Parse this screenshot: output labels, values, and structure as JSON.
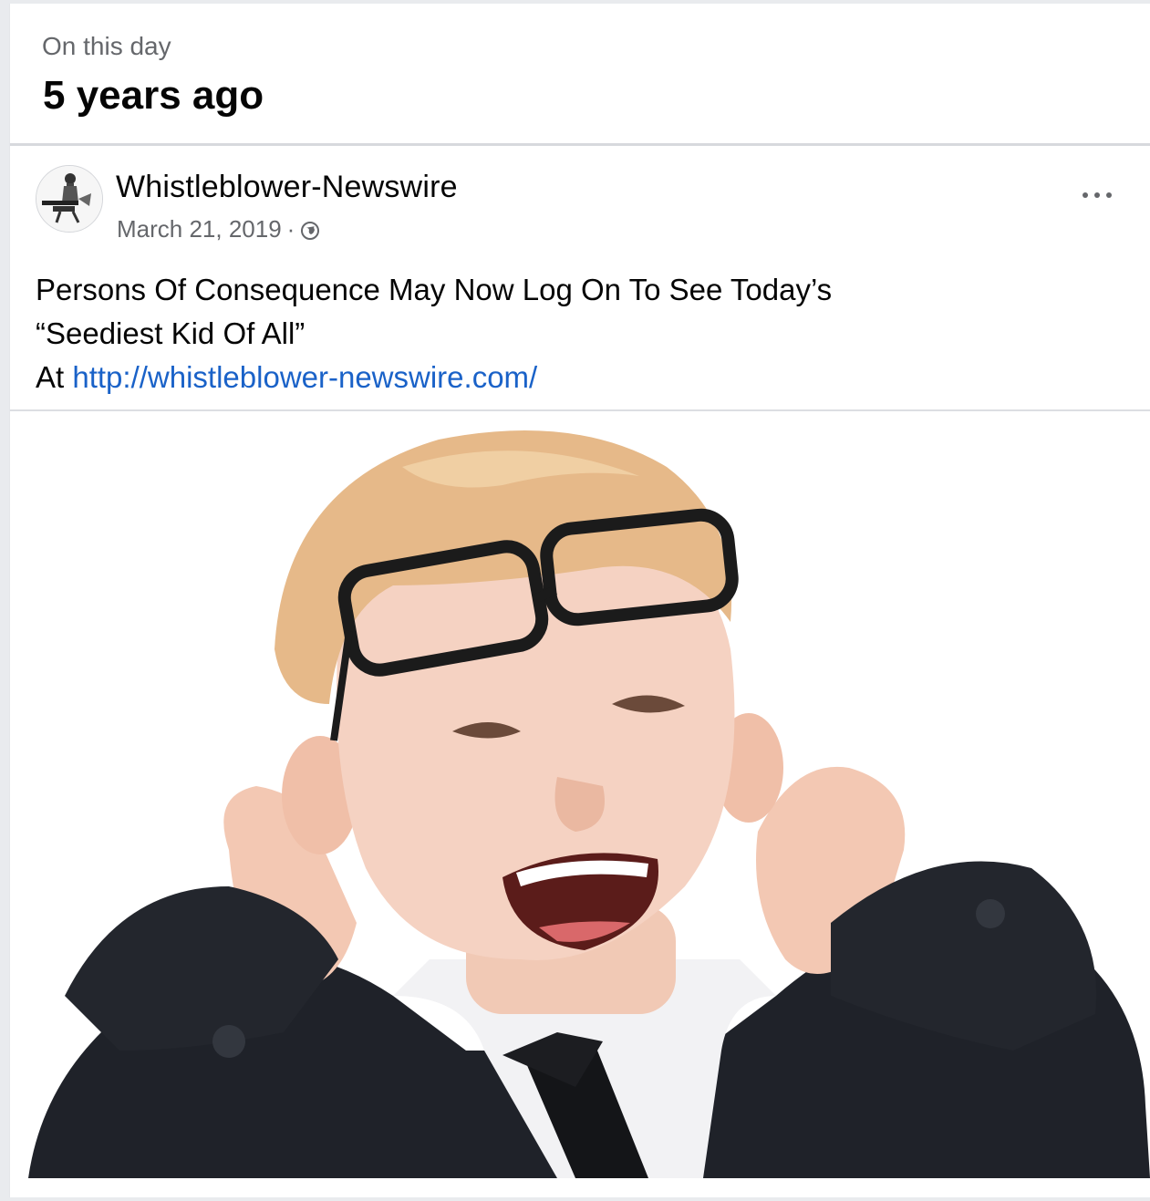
{
  "memories": {
    "label": "On this day",
    "time_ago": "5 years ago"
  },
  "post": {
    "author": "Whistleblower-Newswire",
    "date": "March 21, 2019",
    "separator": "·",
    "audience_icon": "globe-icon",
    "more_icon": "more-options-icon",
    "text_line1": "Persons Of Consequence May Now Log On To See Today’s",
    "text_line2": "“Seediest Kid Of All”",
    "text_line3_prefix": "At",
    "link": "http://whistleblower-newswire.com/",
    "image_subject": "photo of a laughing boy with glasses on his forehead, in a suit and tie, hands behind his ears"
  },
  "colors": {
    "link": "#1a62c8",
    "meta_text": "#65676b",
    "primary_text": "#050505"
  }
}
